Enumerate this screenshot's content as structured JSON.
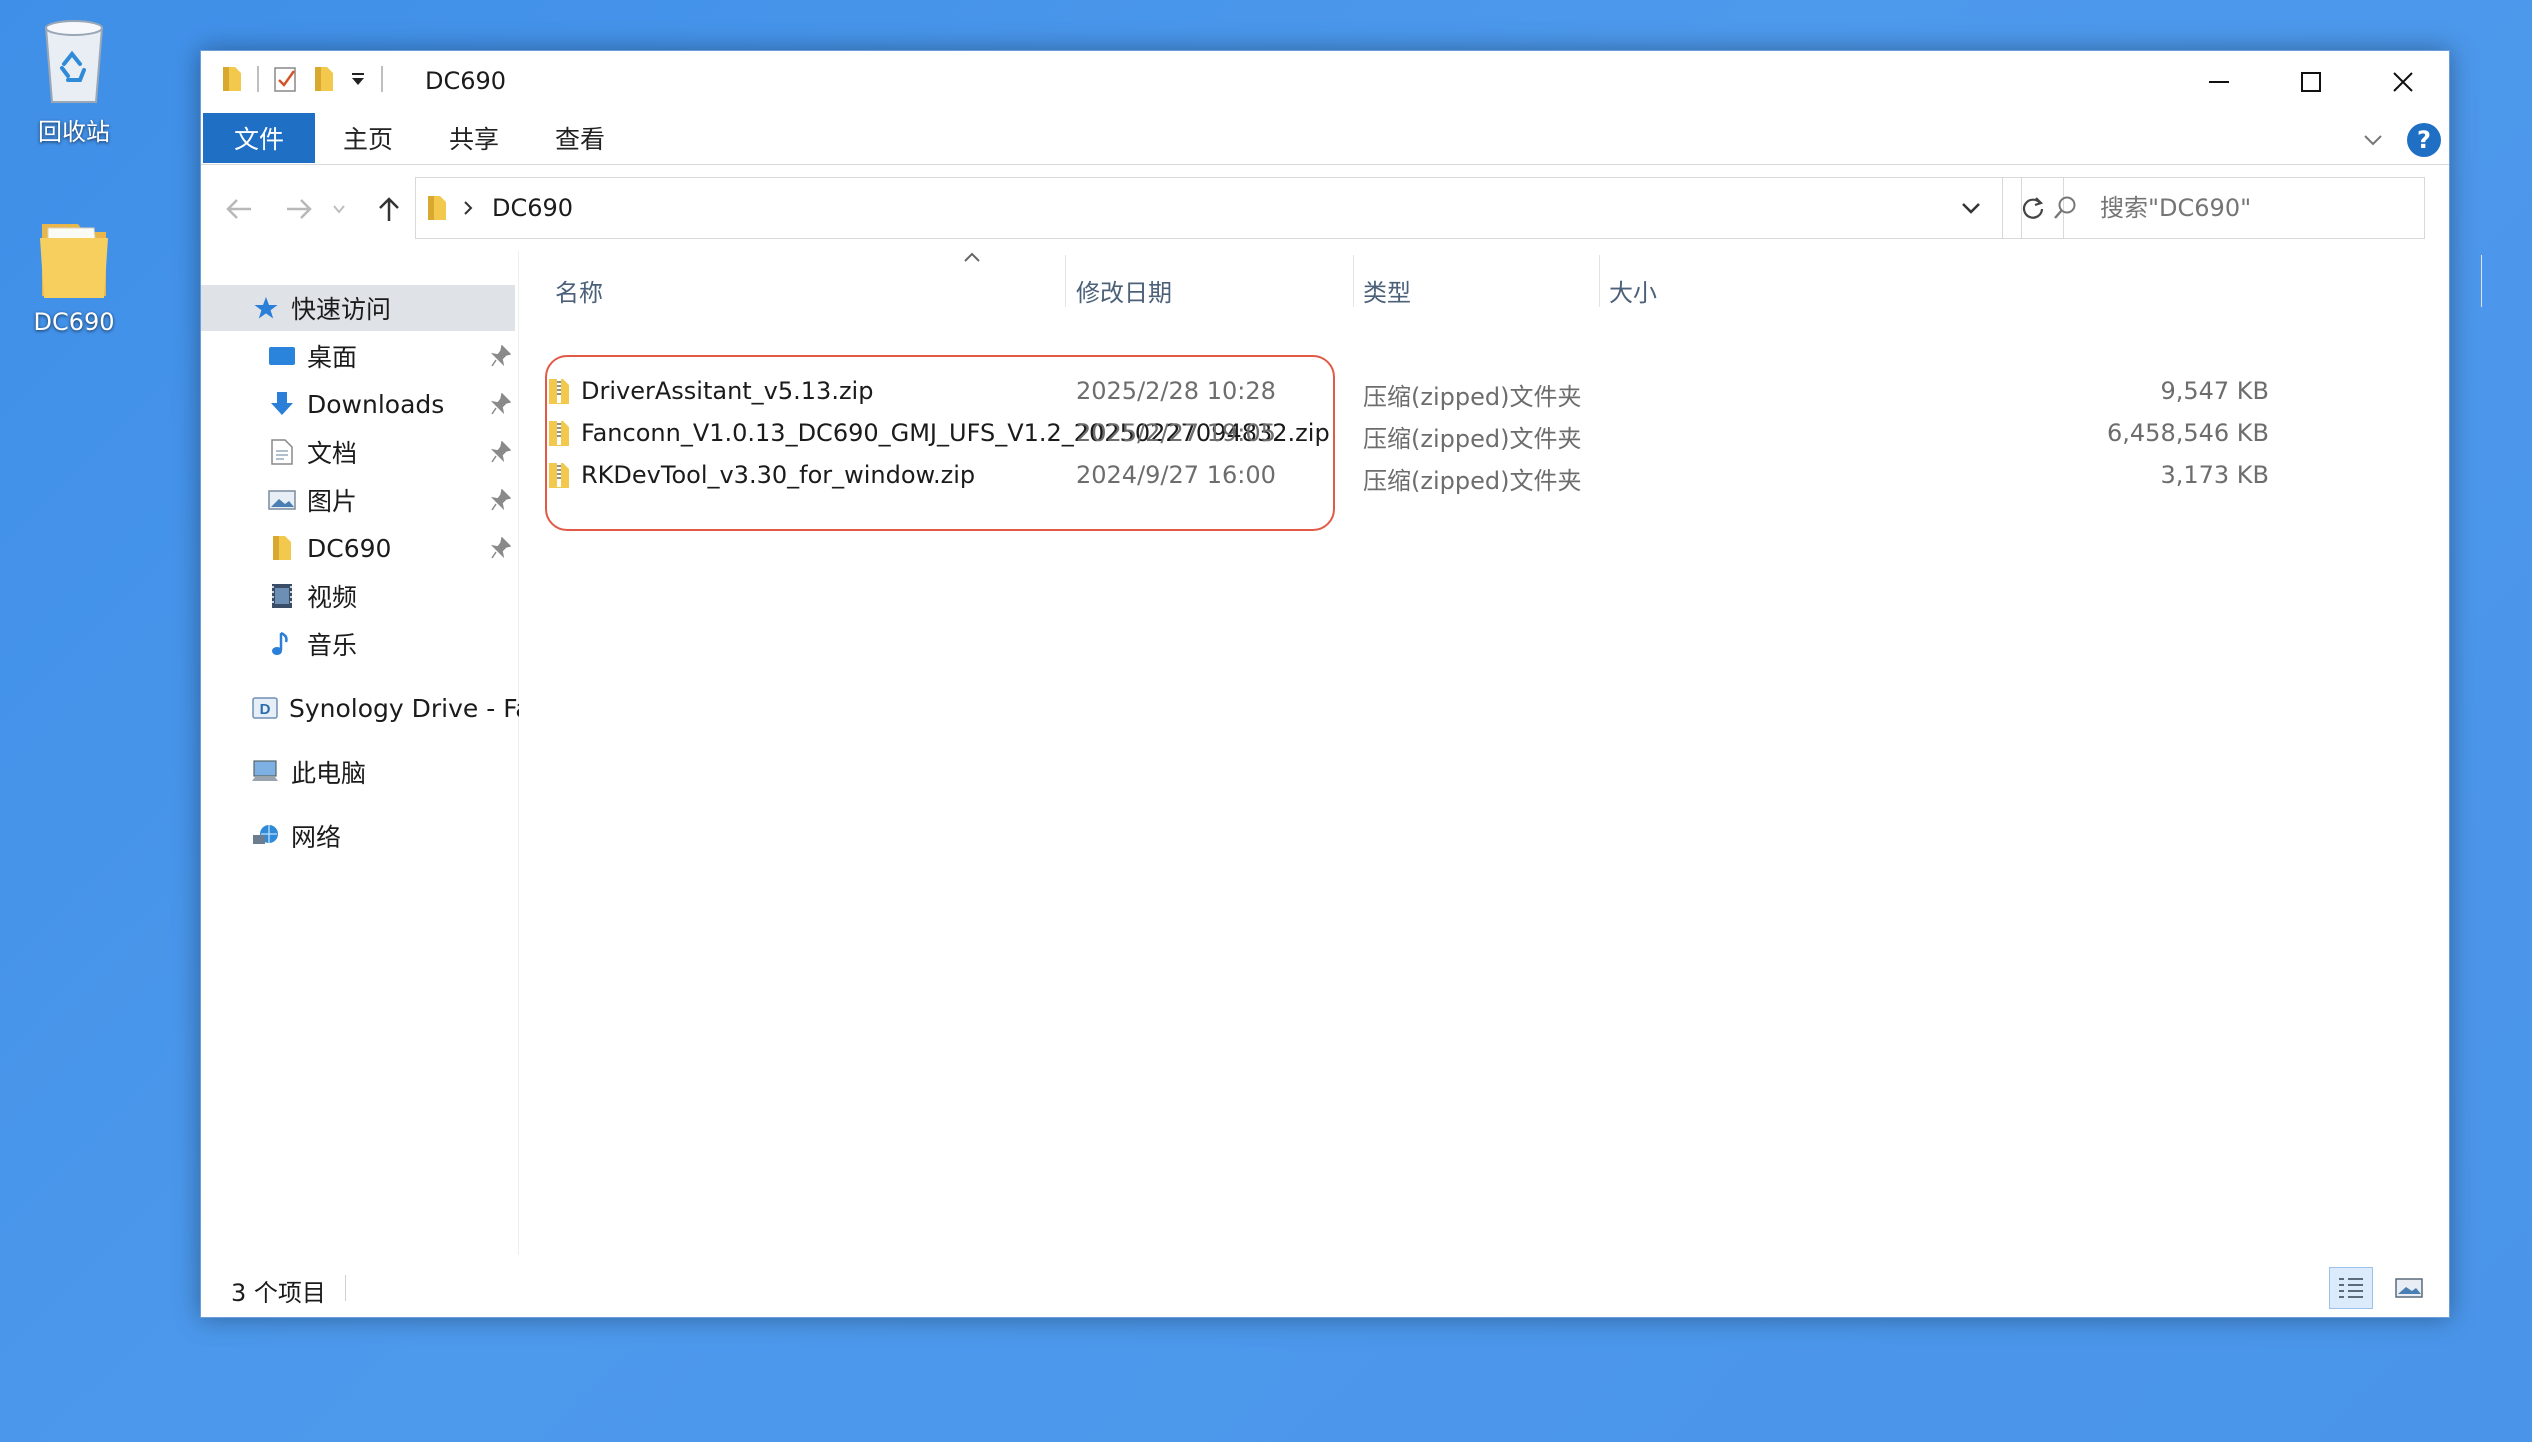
{
  "desktop": {
    "recycle_bin_label": "回收站",
    "folder_label": "DC690"
  },
  "window": {
    "title": "DC690",
    "ribbon_tabs": [
      "文件",
      "主页",
      "共享",
      "查看"
    ]
  },
  "address": {
    "current_folder": "DC690",
    "search_placeholder": "搜索\"DC690\""
  },
  "nav_pane": {
    "quick_access": "快速访问",
    "pinned": [
      "桌面",
      "Downloads",
      "文档",
      "图片",
      "DC690"
    ],
    "others": [
      "视频",
      "音乐"
    ],
    "synology": "Synology Drive - Fanconn",
    "this_pc": "此电脑",
    "network": "网络"
  },
  "file_list": {
    "columns": [
      "名称",
      "修改日期",
      "类型",
      "大小"
    ],
    "rows": [
      {
        "name": "DriverAssitant_v5.13.zip",
        "date": "2025/2/28 10:28",
        "type": "压缩(zipped)文件夹",
        "size": "9,547 KB"
      },
      {
        "name": "Fanconn_V1.0.13_DC690_GMJ_UFS_V1.2_20250227094832.zip",
        "date": "2025/2/27 19:05",
        "type": "压缩(zipped)文件夹",
        "size": "6,458,546 KB"
      },
      {
        "name": "RKDevTool_v3.30_for_window.zip",
        "date": "2024/9/27 16:00",
        "type": "压缩(zipped)文件夹",
        "size": "3,173 KB"
      }
    ]
  },
  "status_bar": {
    "item_count": "3 个项目"
  },
  "colors": {
    "accent": "#1f6fc5",
    "highlight": "#e05a46",
    "desktop": "#4a95ea"
  },
  "icons": {
    "folder": "folder-icon",
    "zip": "zip-folder-icon",
    "recycle": "recycle-bin-icon"
  }
}
